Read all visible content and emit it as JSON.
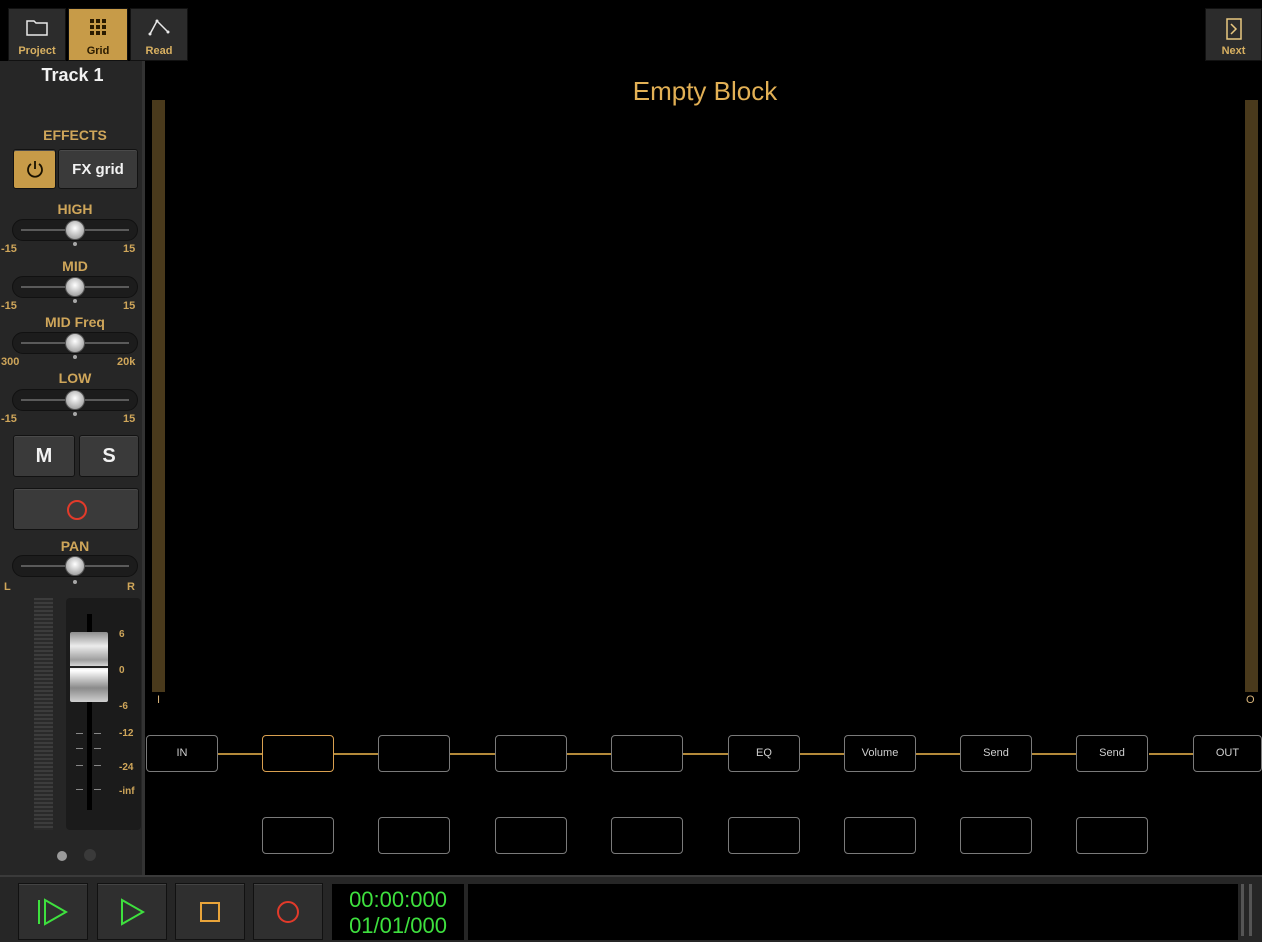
{
  "toolbar": {
    "project_label": "Project",
    "grid_label": "Grid",
    "read_label": "Read",
    "next_label": "Next"
  },
  "strip": {
    "track_title": "Track 1",
    "effects_label": "EFFECTS",
    "fx_grid_label": "FX grid",
    "eq": [
      {
        "label": "HIGH",
        "min": "-15",
        "max": "15"
      },
      {
        "label": "MID",
        "min": "-15",
        "max": "15"
      },
      {
        "label": "MID Freq",
        "min": "300",
        "max": "20k"
      },
      {
        "label": "LOW",
        "min": "-15",
        "max": "15"
      }
    ],
    "mute_label": "M",
    "solo_label": "S",
    "pan_label": "PAN",
    "pan_left": "L",
    "pan_right": "R",
    "fader_scale": [
      "6",
      "0",
      "-6",
      "-12",
      "-24",
      "-inf"
    ]
  },
  "main": {
    "title": "Empty Block",
    "input_label": "I",
    "output_label": "O",
    "chain_row1": [
      "IN",
      "",
      "",
      "",
      "",
      "EQ",
      "Volume",
      "Send",
      "Send",
      "OUT"
    ],
    "chain_row2": [
      "",
      "",
      "",
      "",
      "",
      "",
      "",
      ""
    ]
  },
  "transport": {
    "time": "00:00:000",
    "position": "01/01/000"
  },
  "colors": {
    "accent": "#c79b48",
    "label_gold": "#cfa65a",
    "time_green": "#3ee03e",
    "record_red": "#e23a2a"
  }
}
